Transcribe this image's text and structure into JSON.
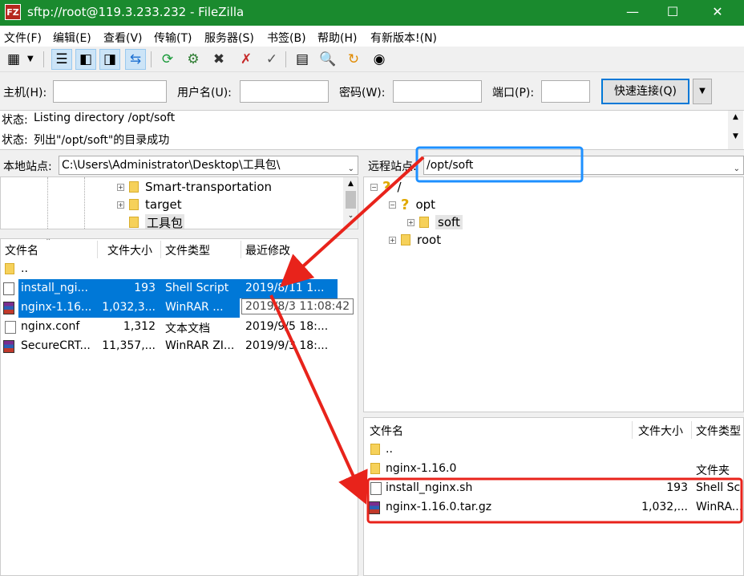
{
  "window": {
    "title": "sftp://root@119.3.233.232 - FileZilla",
    "app_icon": "FZ"
  },
  "menu": [
    "文件(F)",
    "编辑(E)",
    "查看(V)",
    "传输(T)",
    "服务器(S)",
    "书签(B)",
    "帮助(H)",
    "有新版本!(N)"
  ],
  "connect": {
    "host_label": "主机(H):",
    "user_label": "用户名(U):",
    "pass_label": "密码(W):",
    "port_label": "端口(P):",
    "host_value": "",
    "user_value": "",
    "pass_value": "",
    "port_value": "",
    "quick_button": "快速连接(Q)"
  },
  "log": [
    {
      "label": "状态:",
      "text": "Listing directory /opt/soft"
    },
    {
      "label": "状态:",
      "text": "列出\"/opt/soft\"的目录成功"
    }
  ],
  "local": {
    "site_label": "本地站点:",
    "path": "C:\\Users\\Administrator\\Desktop\\工具包\\",
    "tree": [
      "Smart-transportation",
      "target",
      "工具包"
    ],
    "columns": [
      "文件名",
      "文件大小",
      "文件类型",
      "最近修改"
    ],
    "files": [
      {
        "name": "..",
        "size": "",
        "type": "",
        "modified": ""
      },
      {
        "name": "install_ngi...",
        "size": "193",
        "type": "Shell Script",
        "modified": "2019/8/11 1..."
      },
      {
        "name": "nginx-1.16...",
        "size": "1,032,3...",
        "type": "WinRAR ...",
        "modified": "2019/8/3 1..."
      },
      {
        "name": "nginx.conf",
        "size": "1,312",
        "type": "文本文档",
        "modified": "2019/9/5 18:..."
      },
      {
        "name": "SecureCRT...",
        "size": "11,357,...",
        "type": "WinRAR ZI...",
        "modified": "2019/9/3 18:..."
      }
    ],
    "tooltip": "2019/8/3 11:08:42"
  },
  "remote": {
    "site_label": "远程站点:",
    "path": "/opt/soft",
    "tree": [
      {
        "name": "/",
        "icon": "question-icon"
      },
      {
        "name": "opt",
        "icon": "question-icon"
      },
      {
        "name": "soft",
        "icon": "folder-icon"
      },
      {
        "name": "root",
        "icon": "folder-icon"
      }
    ],
    "columns": [
      "文件名",
      "文件大小",
      "文件类型"
    ],
    "files": [
      {
        "name": "..",
        "size": "",
        "type": ""
      },
      {
        "name": "nginx-1.16.0",
        "size": "",
        "type": "文件夹"
      },
      {
        "name": "install_nginx.sh",
        "size": "193",
        "type": "Shell Sc"
      },
      {
        "name": "nginx-1.16.0.tar.gz",
        "size": "1,032,...",
        "type": "WinRA..."
      }
    ]
  },
  "colors": {
    "title_bar": "#1a8a2e",
    "selection": "#0078d7",
    "annotation_red": "#e8231b",
    "annotation_blue": "#1e90ff"
  }
}
